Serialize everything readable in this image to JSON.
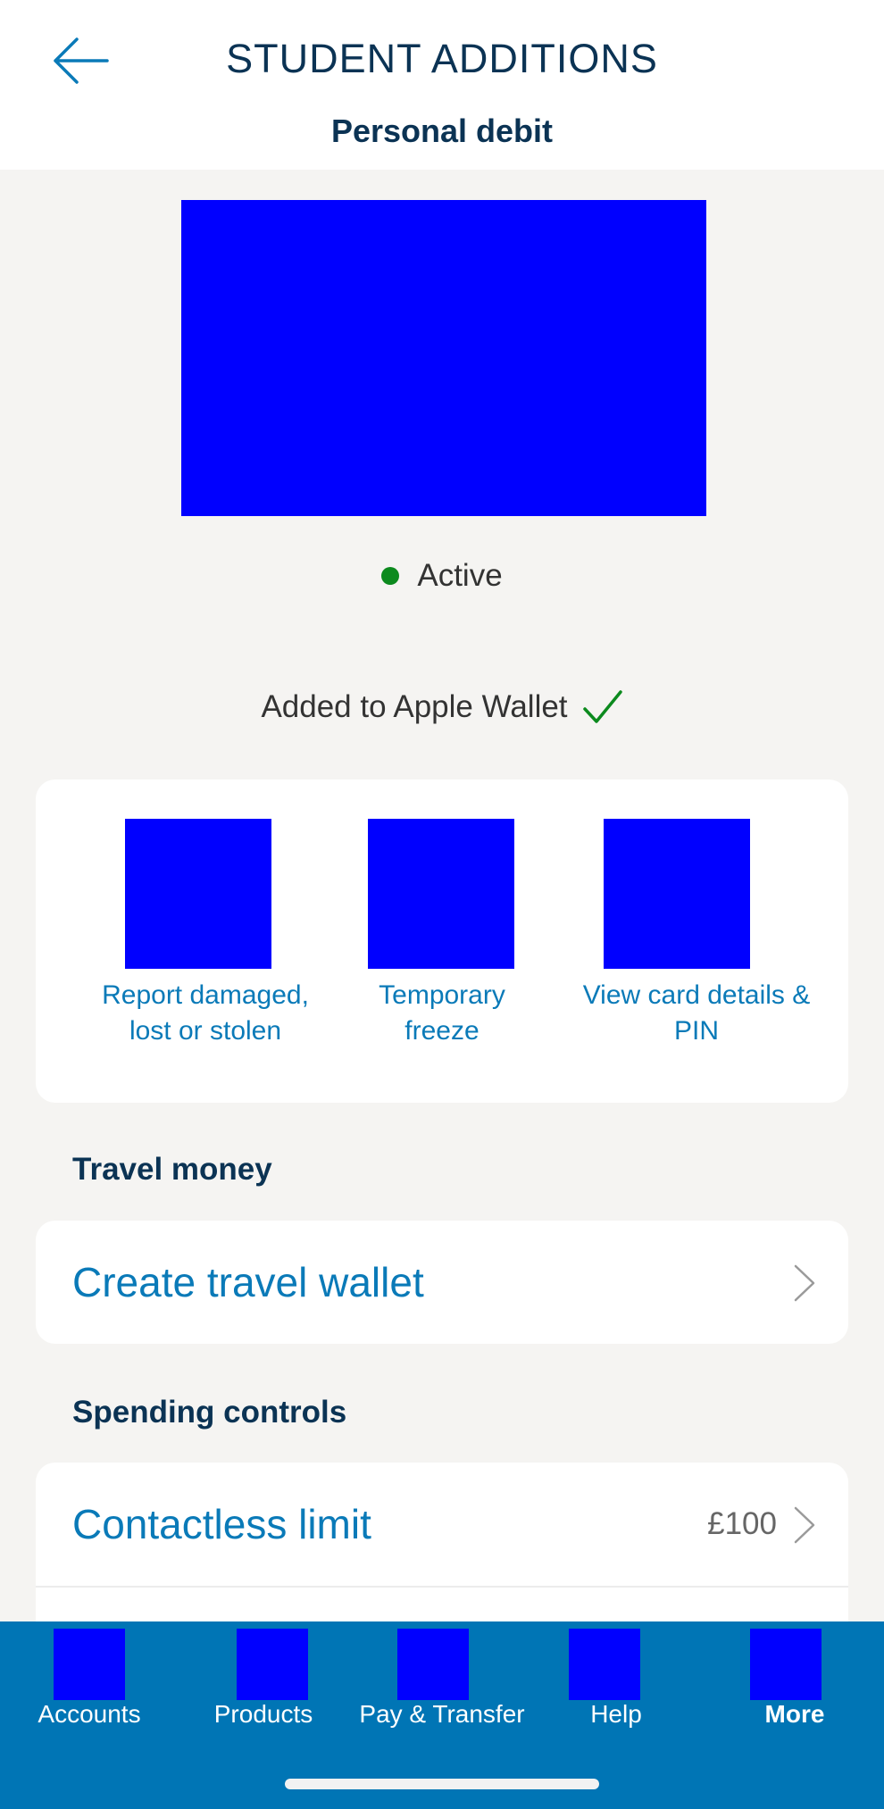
{
  "header": {
    "title": "STUDENT ADDITIONS",
    "subtitle": "Personal debit",
    "back_icon": "arrow-left-icon"
  },
  "card": {
    "status": "Active",
    "status_color": "#0c8a1e",
    "wallet_label": "Added to Apple Wallet",
    "wallet_icon": "checkmark-icon"
  },
  "actions": [
    {
      "label_line1": "Report damaged,",
      "label_line2": "lost or stolen"
    },
    {
      "label_line1": "Temporary",
      "label_line2": "freeze"
    },
    {
      "label_line1": "View card details &",
      "label_line2": "PIN"
    }
  ],
  "travel": {
    "section_title": "Travel money",
    "create_wallet_label": "Create travel wallet"
  },
  "spending": {
    "section_title": "Spending controls",
    "contactless_label": "Contactless limit",
    "contactless_value": "£100"
  },
  "tabs": [
    {
      "label": "Accounts",
      "active": false
    },
    {
      "label": "Products",
      "active": false
    },
    {
      "label": "Pay & Transfer",
      "active": false
    },
    {
      "label": "Help",
      "active": false
    },
    {
      "label": "More",
      "active": true
    }
  ],
  "colors": {
    "brand_blue": "#0075b5",
    "link_blue": "#0a7ab8",
    "heading_navy": "#0b3354",
    "background": "#f5f4f2"
  }
}
